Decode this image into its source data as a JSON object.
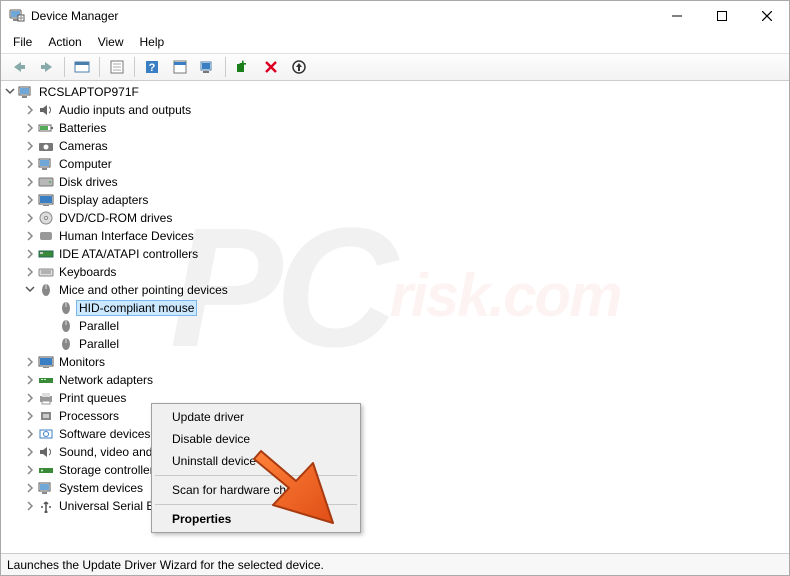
{
  "window": {
    "title": "Device Manager"
  },
  "menubar": [
    "File",
    "Action",
    "View",
    "Help"
  ],
  "toolbar": {
    "back": "Back",
    "forward": "Forward",
    "show_hidden": "Show hidden devices",
    "properties": "Properties",
    "help": "Help",
    "update": "Update driver",
    "scan": "Scan for hardware changes",
    "add_legacy": "Add legacy hardware",
    "uninstall": "Uninstall device",
    "disable": "Disable device"
  },
  "tree": {
    "root": "RCSLAPTOP971F",
    "nodes": [
      "Audio inputs and outputs",
      "Batteries",
      "Cameras",
      "Computer",
      "Disk drives",
      "Display adapters",
      "DVD/CD-ROM drives",
      "Human Interface Devices",
      "IDE ATA/ATAPI controllers",
      "Keyboards",
      "Mice and other pointing devices",
      "Monitors",
      "Network adapters",
      "Print queues",
      "Processors",
      "Software devices",
      "Sound, video and game controllers",
      "Storage controllers",
      "System devices",
      "Universal Serial Bus controllers"
    ],
    "mice_children": {
      "hid": "HID-compliant mouse",
      "parallel1": "Parallel",
      "parallel2": "Parallel"
    }
  },
  "context_menu": {
    "update": "Update driver",
    "disable": "Disable device",
    "uninstall": "Uninstall device",
    "scan": "Scan for hardware changes",
    "properties": "Properties"
  },
  "statusbar": {
    "text": "Launches the Update Driver Wizard for the selected device."
  }
}
